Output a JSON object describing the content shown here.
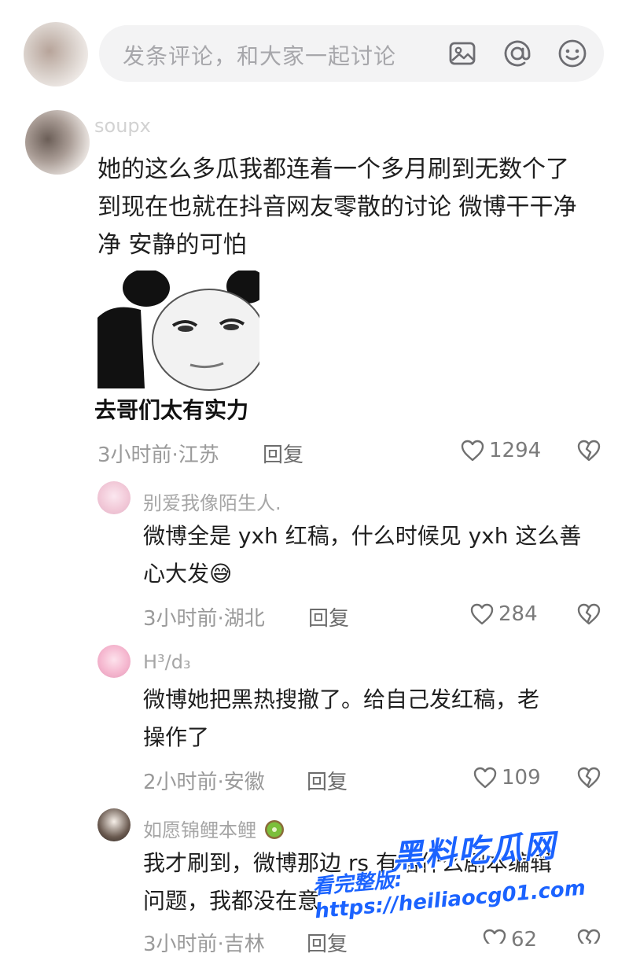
{
  "composer": {
    "placeholder": "发条评论，和大家一起讨论",
    "icons": [
      "image-icon",
      "mention-icon",
      "emoji-icon"
    ]
  },
  "main_comment": {
    "username": "soupx",
    "lines": [
      "她的这么多瓜我都连着一个多月刷到无数个了",
      "到现在也就在抖音网友零散的讨论  微博干干净",
      "净  安静的可怕"
    ],
    "meme_caption": "去哥们太有实力",
    "time": "3小时前·江苏",
    "reply": "回复",
    "likes": "1294"
  },
  "replies": [
    {
      "username": "别爱我像陌生人.",
      "lines": [
        "微博全是 yxh 红稿，什么时候见 yxh 这么善",
        "心大发"
      ],
      "emoji": "😅",
      "time": "3小时前·湖北",
      "reply": "回复",
      "likes": "284"
    },
    {
      "username": "H³∕d₃",
      "lines": [
        "微博她把黑热搜撤了。给自己发红稿，老",
        "操作了"
      ],
      "time": "2小时前·安徽",
      "reply": "回复",
      "likes": "109"
    },
    {
      "username": "如愿锦鲤本鲤",
      "lines": [
        "我才刷到，微博那边 rs 有啥什么剧本编辑",
        "问题，我都没在意"
      ],
      "time": "3小时前·吉林",
      "reply": "回复",
      "likes": "62"
    }
  ],
  "watermark": {
    "brand": "黑料吃瓜网",
    "url": "看完整版: https://heiliaocg01.com"
  },
  "colors": {
    "accent_watermark": "#1b63ff",
    "meta_gray": "#9a9a9a",
    "composer_bg": "#f3f3f4"
  }
}
